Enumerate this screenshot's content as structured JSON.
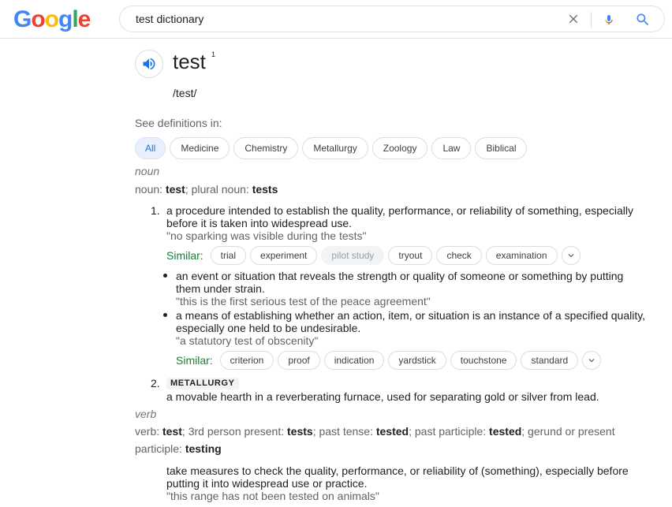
{
  "header": {
    "logo_letters": [
      {
        "char": "G",
        "color": "#4285F4"
      },
      {
        "char": "o",
        "color": "#EA4335"
      },
      {
        "char": "o",
        "color": "#FBBC05"
      },
      {
        "char": "g",
        "color": "#4285F4"
      },
      {
        "char": "l",
        "color": "#34A853"
      },
      {
        "char": "e",
        "color": "#EA4335"
      }
    ],
    "search_value": "test dictionary",
    "icons": {
      "clear": "close-icon",
      "mic": "microphone-icon",
      "search": "search-icon"
    }
  },
  "entry": {
    "word": "test",
    "superscript": "1",
    "pronunciation": "/test/",
    "see_definitions_label": "See definitions in:",
    "domains": [
      "All",
      "Medicine",
      "Chemistry",
      "Metallurgy",
      "Zoology",
      "Law",
      "Biblical"
    ],
    "active_domain": "All"
  },
  "noun": {
    "pos": "noun",
    "forms": {
      "p1": "noun",
      "p2": "test",
      "p3": "; plural noun",
      "p4": "tests"
    },
    "sense1": {
      "number": "1.",
      "definition": "a procedure intended to establish the quality, performance, or reliability of something, especially before it is taken into widespread use.",
      "example": "\"no sparking was visible during the tests\"",
      "similar_label": "Similar:",
      "similar": [
        "trial",
        "experiment",
        "pilot study",
        "tryout",
        "check",
        "examination"
      ],
      "faded_index": 2,
      "subsenses": [
        {
          "definition": "an event or situation that reveals the strength or quality of someone or something by putting them under strain.",
          "example": "\"this is the first serious test of the peace agreement\""
        },
        {
          "definition": "a means of establishing whether an action, item, or situation is an instance of a specified quality, especially one held to be undesirable.",
          "example": "\"a statutory test of obscenity\""
        }
      ],
      "similar2": [
        "criterion",
        "proof",
        "indication",
        "yardstick",
        "touchstone",
        "standard"
      ]
    },
    "sense2": {
      "number": "2.",
      "badge": "METALLURGY",
      "definition": "a movable hearth in a reverberating furnace, used for separating gold or silver from lead."
    }
  },
  "verb": {
    "pos": "verb",
    "forms": {
      "f1": "verb",
      "f2": "test",
      "f3": "; 3rd person present",
      "f4": "tests",
      "f5": "; past tense",
      "f6": "tested",
      "f7": "; past participle",
      "f8": "tested",
      "f9": "; gerund or present participle",
      "f10": "testing"
    },
    "definition": "take measures to check the quality, performance, or reliability of (something), especially before putting it into widespread use or practice.",
    "example": "\"this range has not been tested on animals\""
  }
}
